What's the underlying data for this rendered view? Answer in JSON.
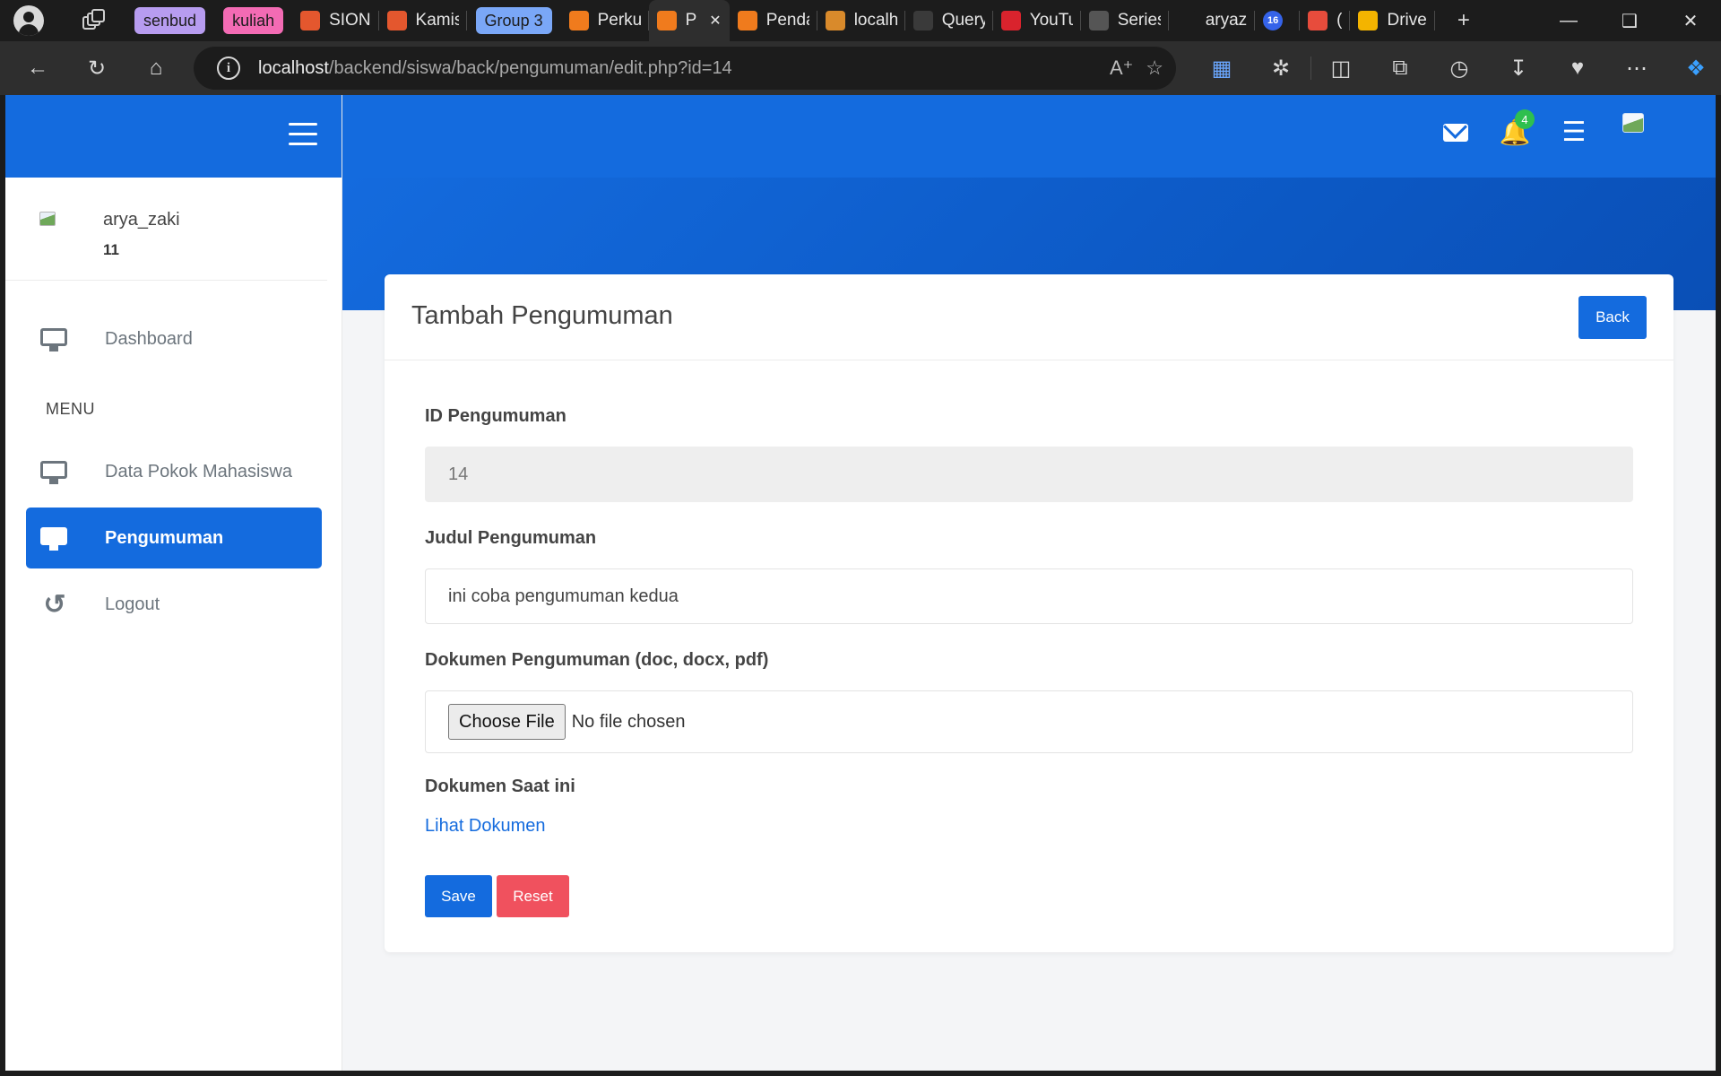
{
  "browser": {
    "tabs": [
      {
        "kind": "group",
        "label": "senbud",
        "color": "#b79cf0"
      },
      {
        "kind": "group",
        "label": "kuliah",
        "color": "#f36bb4"
      },
      {
        "kind": "tab",
        "title": "SION",
        "icon": "flame-icon",
        "fav": "#e4572e"
      },
      {
        "kind": "tab",
        "title": "Kamis",
        "icon": "flame-icon",
        "fav": "#e4572e"
      },
      {
        "kind": "group",
        "label": "Group 3",
        "color": "#7aa7f7"
      },
      {
        "kind": "tab",
        "title": "Perku",
        "icon": "xampp-icon",
        "fav": "#f07b1d"
      },
      {
        "kind": "tab",
        "title": "P",
        "icon": "xampp-icon",
        "fav": "#f07b1d",
        "active": true
      },
      {
        "kind": "tab",
        "title": "Penda",
        "icon": "xampp-icon",
        "fav": "#f07b1d"
      },
      {
        "kind": "tab",
        "title": "localh",
        "icon": "sailboat-icon",
        "fav": "#d98a2b"
      },
      {
        "kind": "tab",
        "title": "Query",
        "icon": "openai-icon",
        "fav": "#3a3a3a"
      },
      {
        "kind": "tab",
        "title": "YouTu",
        "icon": "youtube-icon",
        "fav": "#d9232d"
      },
      {
        "kind": "tab",
        "title": "Series",
        "icon": "medium-icon",
        "fav": "#555555"
      },
      {
        "kind": "tab",
        "title": "aryaz",
        "icon": "github-icon",
        "fav": "#1c1c1c"
      },
      {
        "kind": "tab",
        "title": "",
        "icon": "notification-icon",
        "fav": "#3563e9",
        "count": "16"
      },
      {
        "kind": "tab",
        "title": "(",
        "icon": "record-icon",
        "fav": "#e74c3c"
      },
      {
        "kind": "tab",
        "title": "Drive",
        "icon": "drive-icon",
        "fav": "#f4b400"
      }
    ],
    "url_host": "localhost",
    "url_path": "/backend/siswa/back/pengumuman/edit.php?id=14"
  },
  "sidebar": {
    "user": {
      "name": "arya_zaki",
      "id": "11"
    },
    "dashboard_label": "Dashboard",
    "menu_heading": "MENU",
    "items": [
      {
        "label": "Data Pokok Mahasiswa",
        "icon": "monitor-icon"
      },
      {
        "label": "Pengumuman",
        "icon": "monitor-icon",
        "active": true
      },
      {
        "label": "Logout",
        "icon": "undo-icon"
      }
    ]
  },
  "header": {
    "notification_count": "4"
  },
  "form": {
    "title": "Tambah Pengumuman",
    "back_label": "Back",
    "id_label": "ID Pengumuman",
    "id_value": "14",
    "judul_label": "Judul Pengumuman",
    "judul_value": "ini coba pengumuman kedua",
    "dokumen_label": "Dokumen Pengumuman (doc, docx, pdf)",
    "choose_file_label": "Choose File",
    "no_file_text": "No file chosen",
    "current_doc_label": "Dokumen Saat ini",
    "view_doc_link": "Lihat Dokumen",
    "save_label": "Save",
    "reset_label": "Reset"
  }
}
